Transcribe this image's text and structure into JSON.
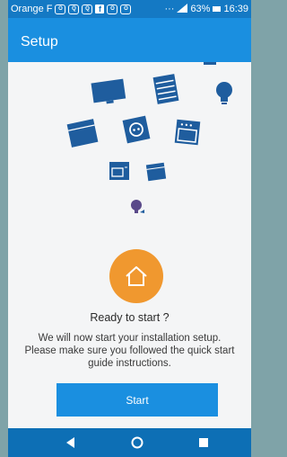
{
  "status_bar": {
    "carrier": "Orange F",
    "icons": [
      "notification-icon",
      "notification-icon",
      "notification-icon",
      "facebook-icon",
      "notification-icon",
      "notification-icon"
    ],
    "overflow": "···",
    "signal": "⁴ᴳ",
    "battery_text": "63%",
    "time": "16:39"
  },
  "header": {
    "title": "Setup"
  },
  "illustration": {
    "icons": [
      "tv-icon",
      "radiator-icon",
      "light-bulb-icon",
      "drawer-icon",
      "socket-icon",
      "oven-icon",
      "microwave-icon",
      "small-box-icon",
      "plug-icon"
    ]
  },
  "main": {
    "home_icon": "home-icon",
    "title": "Ready to start ?",
    "description_lines": [
      "We will now start your installation setup.",
      "Please make sure you followed the quick start",
      "guide instructions."
    ],
    "start_label": "Start"
  },
  "nav": {
    "icons": [
      "back-icon",
      "home-nav-icon",
      "recents-icon"
    ]
  },
  "colors": {
    "status_bar": "#1479c4",
    "app_bar": "#1a8fe0",
    "accent_orange": "#f0982f",
    "device_blue": "#1f5d9e",
    "nav_bar": "#0d6fb5",
    "background": "#f4f5f6"
  }
}
